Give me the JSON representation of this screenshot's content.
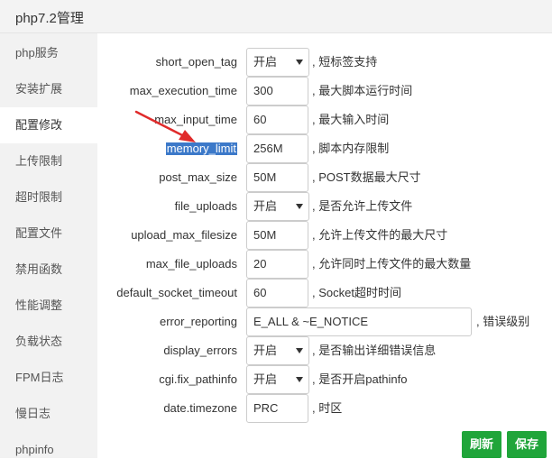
{
  "window": {
    "title": "php7.2管理"
  },
  "sidebar": {
    "items": [
      {
        "label": "php服务"
      },
      {
        "label": "安装扩展"
      },
      {
        "label": "配置修改",
        "active": true
      },
      {
        "label": "上传限制"
      },
      {
        "label": "超时限制"
      },
      {
        "label": "配置文件"
      },
      {
        "label": "禁用函数"
      },
      {
        "label": "性能调整"
      },
      {
        "label": "负载状态"
      },
      {
        "label": "FPM日志"
      },
      {
        "label": "慢日志"
      },
      {
        "label": "phpinfo"
      }
    ]
  },
  "config": {
    "rows": [
      {
        "key": "short_open_tag",
        "type": "select",
        "value": "开启",
        "desc": ", 短标签支持"
      },
      {
        "key": "max_execution_time",
        "type": "input",
        "value": "300",
        "desc": ", 最大脚本运行时间"
      },
      {
        "key": "max_input_time",
        "type": "input",
        "value": "60",
        "desc": ", 最大输入时间"
      },
      {
        "key": "memory_limit",
        "type": "input",
        "value": "256M",
        "desc": ", 脚本内存限制",
        "highlighted": true
      },
      {
        "key": "post_max_size",
        "type": "input",
        "value": "50M",
        "desc": ", POST数据最大尺寸"
      },
      {
        "key": "file_uploads",
        "type": "select",
        "value": "开启",
        "desc": ", 是否允许上传文件"
      },
      {
        "key": "upload_max_filesize",
        "type": "input",
        "value": "50M",
        "desc": ", 允许上传文件的最大尺寸"
      },
      {
        "key": "max_file_uploads",
        "type": "input",
        "value": "20",
        "desc": ", 允许同时上传文件的最大数量"
      },
      {
        "key": "default_socket_timeout",
        "type": "input",
        "value": "60",
        "desc": ", Socket超时时间"
      },
      {
        "key": "error_reporting",
        "type": "wide",
        "value": "E_ALL & ~E_NOTICE",
        "desc": ", 错误级别"
      },
      {
        "key": "display_errors",
        "type": "select",
        "value": "开启",
        "desc": ", 是否输出详细错误信息"
      },
      {
        "key": "cgi.fix_pathinfo",
        "type": "select",
        "value": "开启",
        "desc": ", 是否开启pathinfo"
      },
      {
        "key": "date.timezone",
        "type": "input",
        "value": "PRC",
        "desc": ", 时区"
      }
    ]
  },
  "actions": {
    "refresh_label": "刷新",
    "save_label": "保存"
  },
  "colors": {
    "accent": "#20a53a",
    "highlight": "#3c79c9",
    "annotation_arrow": "#e02b2b",
    "sidebar_bg": "#f2f2f2"
  }
}
